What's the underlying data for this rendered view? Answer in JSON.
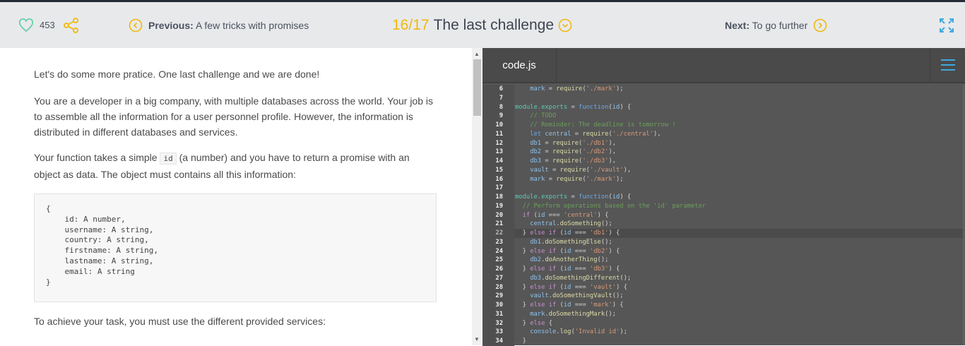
{
  "header": {
    "likes": "453",
    "previous_label": "Previous:",
    "previous_title": "A few tricks with promises",
    "progress": "16/17",
    "title": "The last challenge",
    "next_label": "Next:",
    "next_title": "To go further",
    "colors": {
      "accent": "#f0b90b",
      "heart": "#5ecfa5",
      "expand": "#3fa9e0"
    }
  },
  "lesson": {
    "p1": "Let's do some more pratice. One last challenge and we are done!",
    "p2": "You are a developer in a big company, with multiple databases across the world. Your job is to assemble all the information for a user personnel profile. However, the information is distributed in different databases and services.",
    "p3_a": "Your function takes a simple ",
    "p3_code": "id",
    "p3_b": " (a number) and you have to return a promise with an object as data. The object must contains all this information:",
    "codeblock": "{\n    id: A number,\n    username: A string,\n    country: A string,\n    firstname: A string,\n    lastname: A string,\n    email: A string\n}",
    "p4": "To achieve your task, you must use the different provided services:"
  },
  "editor": {
    "tab": "code.js",
    "active_line": 22,
    "lines": [
      {
        "n": "6",
        "t": [
          [
            "p",
            "    "
          ],
          [
            "v",
            "mark"
          ],
          [
            "p",
            " = "
          ],
          [
            "fn",
            "require"
          ],
          [
            "p",
            "("
          ],
          [
            "str",
            "'./mark'"
          ],
          [
            "p",
            ");"
          ]
        ]
      },
      {
        "n": "7",
        "t": []
      },
      {
        "n": "8",
        "t": [
          [
            "prop",
            "module.exports"
          ],
          [
            "p",
            " = "
          ],
          [
            "kw",
            "function"
          ],
          [
            "p",
            "("
          ],
          [
            "v",
            "id"
          ],
          [
            "p",
            ") {"
          ]
        ]
      },
      {
        "n": "9",
        "t": [
          [
            "p",
            "    "
          ],
          [
            "com",
            "// TODO"
          ]
        ]
      },
      {
        "n": "10",
        "t": [
          [
            "p",
            "    "
          ],
          [
            "com",
            "// Reminder: The deadline is tomorrow !"
          ]
        ]
      },
      {
        "n": "11",
        "t": [
          [
            "p",
            "    "
          ],
          [
            "kw",
            "let "
          ],
          [
            "v",
            "central"
          ],
          [
            "p",
            " = "
          ],
          [
            "fn",
            "require"
          ],
          [
            "p",
            "("
          ],
          [
            "str",
            "'./central'"
          ],
          [
            "p",
            "),"
          ]
        ]
      },
      {
        "n": "12",
        "t": [
          [
            "p",
            "    "
          ],
          [
            "v",
            "db1"
          ],
          [
            "p",
            " = "
          ],
          [
            "fn",
            "require"
          ],
          [
            "p",
            "("
          ],
          [
            "str",
            "'./db1'"
          ],
          [
            "p",
            "),"
          ]
        ]
      },
      {
        "n": "13",
        "t": [
          [
            "p",
            "    "
          ],
          [
            "v",
            "db2"
          ],
          [
            "p",
            " = "
          ],
          [
            "fn",
            "require"
          ],
          [
            "p",
            "("
          ],
          [
            "str",
            "'./db2'"
          ],
          [
            "p",
            "),"
          ]
        ]
      },
      {
        "n": "14",
        "t": [
          [
            "p",
            "    "
          ],
          [
            "v",
            "db3"
          ],
          [
            "p",
            " = "
          ],
          [
            "fn",
            "require"
          ],
          [
            "p",
            "("
          ],
          [
            "str",
            "'./db3'"
          ],
          [
            "p",
            "),"
          ]
        ]
      },
      {
        "n": "15",
        "t": [
          [
            "p",
            "    "
          ],
          [
            "v",
            "vault"
          ],
          [
            "p",
            " = "
          ],
          [
            "fn",
            "require"
          ],
          [
            "p",
            "("
          ],
          [
            "str",
            "'./vault'"
          ],
          [
            "p",
            "),"
          ]
        ]
      },
      {
        "n": "16",
        "t": [
          [
            "p",
            "    "
          ],
          [
            "v",
            "mark"
          ],
          [
            "p",
            " = "
          ],
          [
            "fn",
            "require"
          ],
          [
            "p",
            "("
          ],
          [
            "str",
            "'./mark'"
          ],
          [
            "p",
            ");"
          ]
        ]
      },
      {
        "n": "17",
        "t": []
      },
      {
        "n": "18",
        "t": [
          [
            "prop",
            "module.exports"
          ],
          [
            "p",
            " = "
          ],
          [
            "kw",
            "function"
          ],
          [
            "p",
            "("
          ],
          [
            "v",
            "id"
          ],
          [
            "p",
            ") {"
          ]
        ]
      },
      {
        "n": "19",
        "t": [
          [
            "p",
            "  "
          ],
          [
            "com",
            "// Perform operations based on the 'id' parameter"
          ]
        ]
      },
      {
        "n": "20",
        "t": [
          [
            "p",
            "  "
          ],
          [
            "ctl",
            "if"
          ],
          [
            "p",
            " ("
          ],
          [
            "v",
            "id"
          ],
          [
            "p",
            " === "
          ],
          [
            "str",
            "'central'"
          ],
          [
            "p",
            ") {"
          ]
        ]
      },
      {
        "n": "21",
        "t": [
          [
            "p",
            "    "
          ],
          [
            "v",
            "central"
          ],
          [
            "p",
            "."
          ],
          [
            "fn",
            "doSomething"
          ],
          [
            "p",
            "();"
          ]
        ]
      },
      {
        "n": "22",
        "t": [
          [
            "p",
            "  } "
          ],
          [
            "ctl",
            "else if"
          ],
          [
            "p",
            " ("
          ],
          [
            "v",
            "id"
          ],
          [
            "p",
            " === "
          ],
          [
            "str",
            "'db1'"
          ],
          [
            "p",
            ") {"
          ]
        ]
      },
      {
        "n": "23",
        "t": [
          [
            "p",
            "    "
          ],
          [
            "v",
            "db1"
          ],
          [
            "p",
            "."
          ],
          [
            "fn",
            "doSomethingElse"
          ],
          [
            "p",
            "();"
          ]
        ]
      },
      {
        "n": "24",
        "t": [
          [
            "p",
            "  } "
          ],
          [
            "ctl",
            "else if"
          ],
          [
            "p",
            " ("
          ],
          [
            "v",
            "id"
          ],
          [
            "p",
            " === "
          ],
          [
            "str",
            "'db2'"
          ],
          [
            "p",
            ") {"
          ]
        ]
      },
      {
        "n": "25",
        "t": [
          [
            "p",
            "    "
          ],
          [
            "v",
            "db2"
          ],
          [
            "p",
            "."
          ],
          [
            "fn",
            "doAnotherThing"
          ],
          [
            "p",
            "();"
          ]
        ]
      },
      {
        "n": "26",
        "t": [
          [
            "p",
            "  } "
          ],
          [
            "ctl",
            "else if"
          ],
          [
            "p",
            " ("
          ],
          [
            "v",
            "id"
          ],
          [
            "p",
            " === "
          ],
          [
            "str",
            "'db3'"
          ],
          [
            "p",
            ") {"
          ]
        ]
      },
      {
        "n": "27",
        "t": [
          [
            "p",
            "    "
          ],
          [
            "v",
            "db3"
          ],
          [
            "p",
            "."
          ],
          [
            "fn",
            "doSomethingDifferent"
          ],
          [
            "p",
            "();"
          ]
        ]
      },
      {
        "n": "28",
        "t": [
          [
            "p",
            "  } "
          ],
          [
            "ctl",
            "else if"
          ],
          [
            "p",
            " ("
          ],
          [
            "v",
            "id"
          ],
          [
            "p",
            " === "
          ],
          [
            "str",
            "'vault'"
          ],
          [
            "p",
            ") {"
          ]
        ]
      },
      {
        "n": "29",
        "t": [
          [
            "p",
            "    "
          ],
          [
            "v",
            "vault"
          ],
          [
            "p",
            "."
          ],
          [
            "fn",
            "doSomethingVault"
          ],
          [
            "p",
            "();"
          ]
        ]
      },
      {
        "n": "30",
        "t": [
          [
            "p",
            "  } "
          ],
          [
            "ctl",
            "else if"
          ],
          [
            "p",
            " ("
          ],
          [
            "v",
            "id"
          ],
          [
            "p",
            " === "
          ],
          [
            "str",
            "'mark'"
          ],
          [
            "p",
            ") {"
          ]
        ]
      },
      {
        "n": "31",
        "t": [
          [
            "p",
            "    "
          ],
          [
            "v",
            "mark"
          ],
          [
            "p",
            "."
          ],
          [
            "fn",
            "doSomethingMark"
          ],
          [
            "p",
            "();"
          ]
        ]
      },
      {
        "n": "32",
        "t": [
          [
            "p",
            "  } "
          ],
          [
            "ctl",
            "else"
          ],
          [
            "p",
            " {"
          ]
        ]
      },
      {
        "n": "33",
        "t": [
          [
            "p",
            "    "
          ],
          [
            "v",
            "console"
          ],
          [
            "p",
            "."
          ],
          [
            "fn",
            "log"
          ],
          [
            "p",
            "("
          ],
          [
            "str",
            "'Invalid id'"
          ],
          [
            "p",
            ");"
          ]
        ]
      },
      {
        "n": "34",
        "t": [
          [
            "p",
            "  }"
          ]
        ]
      }
    ]
  }
}
